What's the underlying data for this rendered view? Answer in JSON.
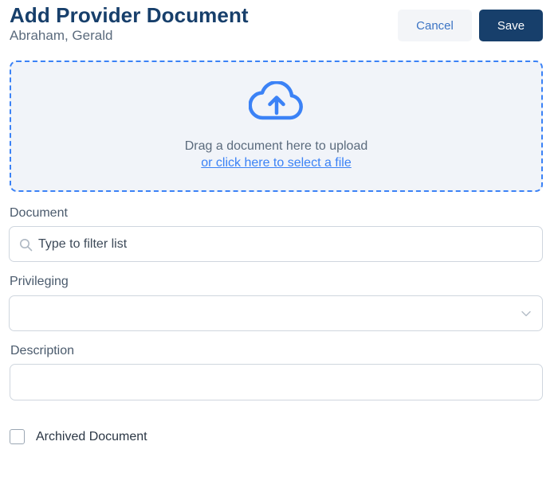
{
  "header": {
    "title": "Add Provider Document",
    "subtitle": "Abraham, Gerald",
    "cancel_label": "Cancel",
    "save_label": "Save"
  },
  "upload": {
    "icon": "cloud-upload-icon",
    "instruction": "Drag a document here to upload",
    "link_text": "or click here to select a file"
  },
  "form": {
    "document": {
      "label": "Document",
      "placeholder": "Type to filter list",
      "value": "",
      "icon": "search-icon"
    },
    "privileging": {
      "label": "Privileging",
      "value": "",
      "icon": "chevron-down-icon"
    },
    "description": {
      "label": "Description",
      "value": ""
    },
    "archived": {
      "label": "Archived Document",
      "checked": false
    }
  },
  "colors": {
    "primary": "#173f6b",
    "accent": "#3b82f6",
    "dropzone_bg": "#f1f4f9"
  }
}
